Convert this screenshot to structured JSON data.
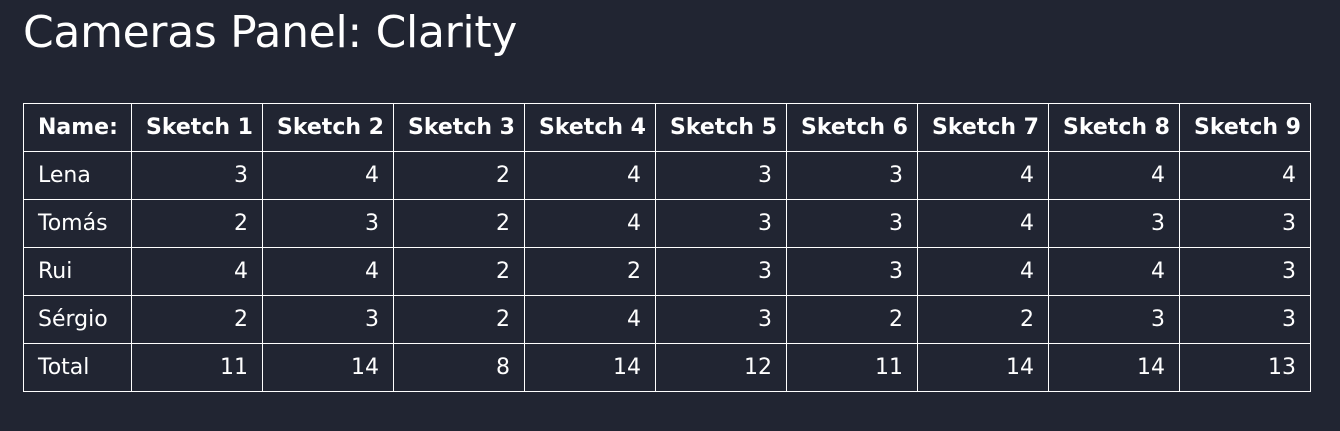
{
  "title": "Cameras Panel: Clarity",
  "table": {
    "headers": [
      "Name:",
      "Sketch 1",
      "Sketch 2",
      "Sketch 3",
      "Sketch 4",
      "Sketch 5",
      "Sketch 6",
      "Sketch 7",
      "Sketch 8",
      "Sketch 9"
    ],
    "rows": [
      [
        "Lena",
        "3",
        "4",
        "2",
        "4",
        "3",
        "3",
        "4",
        "4",
        "4"
      ],
      [
        "Tomás",
        "2",
        "3",
        "2",
        "4",
        "3",
        "3",
        "4",
        "3",
        "3"
      ],
      [
        "Rui",
        "4",
        "4",
        "2",
        "2",
        "3",
        "3",
        "4",
        "4",
        "3"
      ],
      [
        "Sérgio",
        "2",
        "3",
        "2",
        "4",
        "3",
        "2",
        "2",
        "3",
        "3"
      ],
      [
        "Total",
        "11",
        "14",
        "8",
        "14",
        "12",
        "11",
        "14",
        "14",
        "13"
      ]
    ]
  }
}
